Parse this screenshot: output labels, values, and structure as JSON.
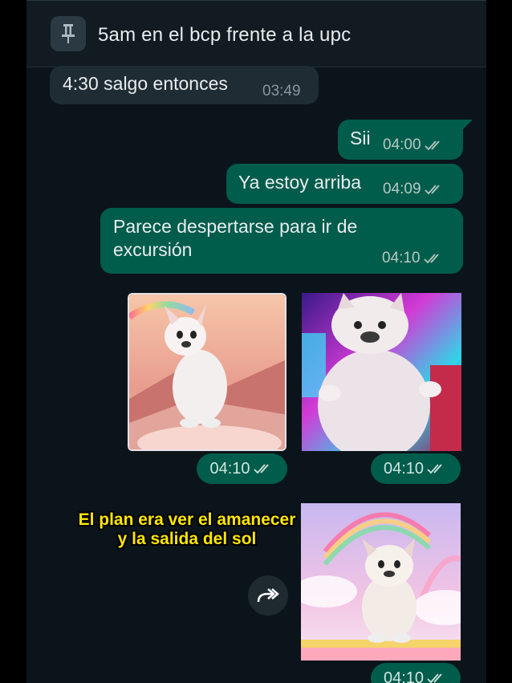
{
  "pinned": {
    "text": "5am en el bcp frente a la upc",
    "icon": "pin-icon"
  },
  "messages": [
    {
      "text": "4:30 salgo entonces",
      "time": "03:49",
      "direction": "incoming"
    },
    {
      "text": "Sii",
      "time": "04:00",
      "direction": "outgoing",
      "status": "read-ticks-icon"
    },
    {
      "text": "Ya estoy arriba",
      "time": "04:09",
      "direction": "outgoing",
      "status": "read-ticks-icon"
    },
    {
      "line1": "Parece despertarse para ir de",
      "line2": "excursión",
      "time": "04:10",
      "direction": "outgoing",
      "status": "read-ticks-icon"
    }
  ],
  "images": [
    {
      "description_icon": "puppy-rainbow-sunset-image",
      "time": "04:10"
    },
    {
      "description_icon": "puppy-neon-image",
      "time": "04:10"
    },
    {
      "description_icon": "puppy-rainbow-clouds-image",
      "time": "04:10"
    }
  ],
  "overlay_caption": {
    "line1": "El plan era ver el amanecer",
    "line2": "y la salida del sol"
  },
  "forward_button": {
    "icon": "forward-icon"
  },
  "colors": {
    "chat_bg": "#0b141a",
    "incoming": "#202c33",
    "outgoing": "#005c4b",
    "caption": "#ffe600"
  }
}
